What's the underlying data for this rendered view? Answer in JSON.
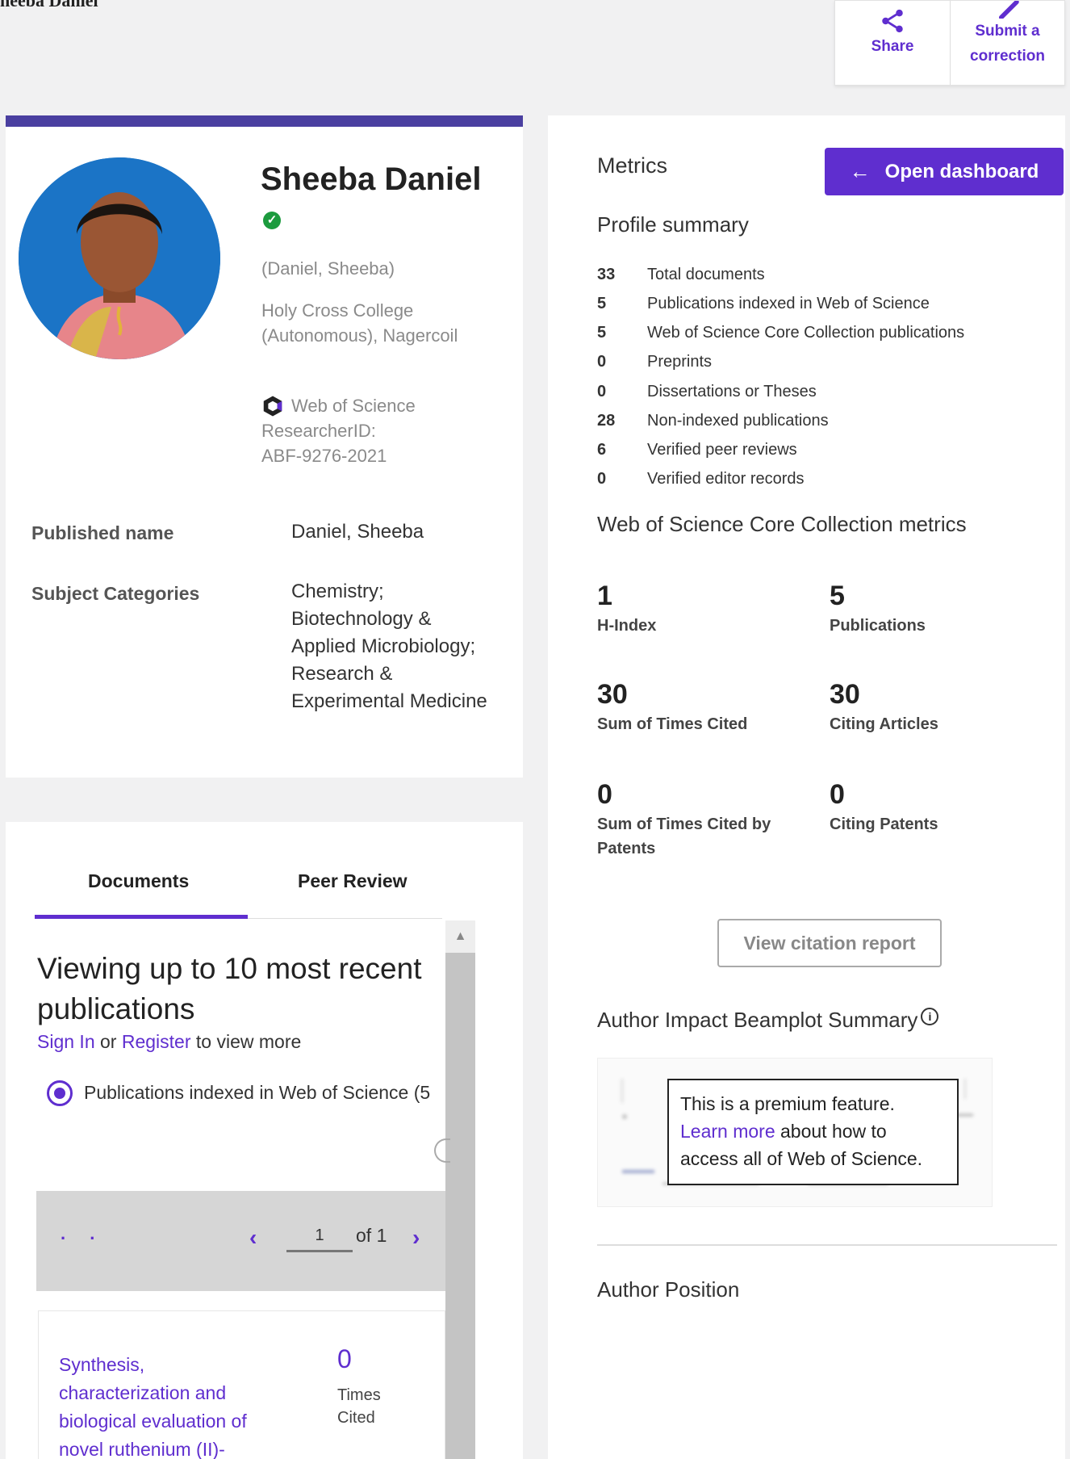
{
  "top_fragment": "heeba Daniel",
  "actions": {
    "share": "Share",
    "submit_correction": "Submit a correction"
  },
  "profile": {
    "name": "Sheeba Daniel",
    "alt_name": "(Daniel, Sheeba)",
    "affiliation_line1": "Holy Cross College",
    "affiliation_line2": "(Autonomous), Nagercoil",
    "wos_brand": "Web of Science",
    "researcher_id_label": "ResearcherID:",
    "researcher_id": "ABF-9276-2021",
    "published_name_label": "Published name",
    "published_name": "Daniel, Sheeba",
    "subject_label": "Subject Categories",
    "subjects": [
      "Chemistry;",
      "Biotechnology &",
      "Applied Microbiology;",
      "Research &",
      "Experimental Medicine"
    ]
  },
  "metrics": {
    "title": "Metrics",
    "open_dashboard": "Open dashboard",
    "profile_summary_title": "Profile summary",
    "summary": [
      {
        "n": "33",
        "label": "Total documents"
      },
      {
        "n": "5",
        "label": "Publications indexed in Web of Science"
      },
      {
        "n": "5",
        "label": "Web of Science Core Collection publications"
      },
      {
        "n": "0",
        "label": "Preprints"
      },
      {
        "n": "0",
        "label": "Dissertations or Theses"
      },
      {
        "n": "28",
        "label": "Non-indexed publications"
      },
      {
        "n": "6",
        "label": "Verified peer reviews"
      },
      {
        "n": "0",
        "label": "Verified editor records"
      }
    ],
    "core_title": "Web of Science Core Collection metrics",
    "core": [
      {
        "value": "1",
        "label": "H-Index"
      },
      {
        "value": "5",
        "label": "Publications"
      },
      {
        "value": "30",
        "label": "Sum of Times Cited"
      },
      {
        "value": "30",
        "label": "Citing Articles"
      },
      {
        "value": "0",
        "label": "Sum of Times Cited by Patents"
      },
      {
        "value": "0",
        "label": "Citing Patents"
      }
    ],
    "citation_report": "View citation report",
    "beamplot_title": "Author Impact Beamplot Summary",
    "premium_line1": "This is a premium feature.",
    "premium_link": "Learn more",
    "premium_line2": " about how to",
    "premium_line3": "access all of Web of Science.",
    "author_position": "Author Position"
  },
  "documents": {
    "tabs": [
      "Documents",
      "Peer Review"
    ],
    "viewing_title": "Viewing up to 10 most recent publications",
    "sign_in": "Sign In",
    "or": " or ",
    "register": "Register",
    "to_view_more": " to view more",
    "radio_label": "Publications indexed in Web of Science (5",
    "pager": {
      "dots": ". .",
      "page": "1",
      "of": "of 1"
    },
    "item": {
      "title_lines": [
        "Synthesis,",
        "characterization and",
        "biological evaluation of",
        "novel ruthenium (II)-"
      ],
      "times_cited": "0",
      "times_cited_label_1": "Times",
      "times_cited_label_2": "Cited"
    }
  }
}
